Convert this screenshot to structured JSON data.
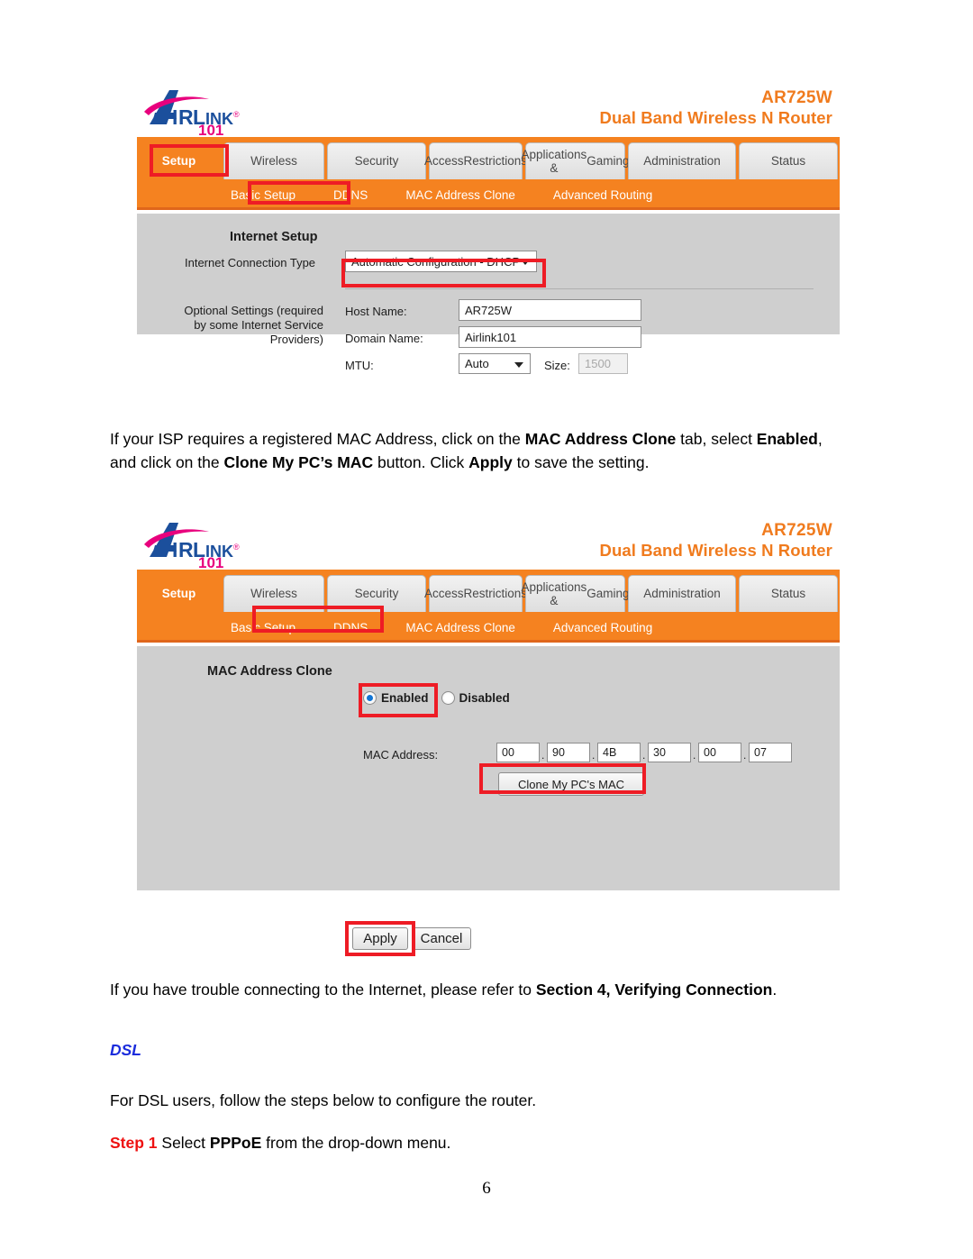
{
  "document": {
    "page_number": "6"
  },
  "router_ui": {
    "brand": {
      "logo_main": "IRLINK",
      "logo_letter": "A",
      "logo_sub": "101",
      "logo_reg": "®",
      "model": "AR725W",
      "description": "Dual Band Wireless N Router"
    },
    "tabs": [
      {
        "label": "Setup",
        "active": true
      },
      {
        "label": "Wireless",
        "active": false
      },
      {
        "label": "Security",
        "active": false
      },
      {
        "label": "Access\nRestrictions",
        "line1": "Access",
        "line2": "Restrictions",
        "active": false
      },
      {
        "label": "Applications &\nGaming",
        "line1": "Applications &",
        "line2": "Gaming",
        "active": false
      },
      {
        "label": "Administration",
        "active": false
      },
      {
        "label": "Status",
        "active": false
      }
    ],
    "subtabs": [
      {
        "label": "Basic Setup"
      },
      {
        "label": "DDNS"
      },
      {
        "label": "MAC Address Clone"
      },
      {
        "label": "Advanced Routing"
      }
    ]
  },
  "screenshot_1": {
    "active_subtab": "Basic Setup",
    "section_title": "Internet Setup",
    "connection_type_label": "Internet Connection Type",
    "connection_type_value": "Automatic Configuration - DHCP",
    "optional_settings_label_line1": "Optional Settings (required",
    "optional_settings_label_line2": "by some Internet Service",
    "optional_settings_label_line3": "Providers)",
    "host_name_label": "Host Name:",
    "host_name_value": "AR725W",
    "domain_name_label": "Domain Name:",
    "domain_name_value": "Airlink101",
    "mtu_label": "MTU:",
    "mtu_value": "Auto",
    "size_label": "Size:",
    "size_value": "1500"
  },
  "screenshot_2": {
    "active_subtab": "MAC Address Clone",
    "section_title": "MAC Address Clone",
    "enabled_label": "Enabled",
    "disabled_label": "Disabled",
    "enabled_selected": true,
    "mac_address_label": "MAC Address:",
    "mac_octets": [
      "00",
      "90",
      "4B",
      "30",
      "00",
      "07"
    ],
    "clone_button_label": "Clone My PC's MAC",
    "apply_button_label": "Apply",
    "cancel_button_label": "Cancel"
  },
  "body_text": {
    "paragraph_1": {
      "seg_1": "If your ISP requires a registered MAC Address, click on the ",
      "seg_2_bold": "MAC Address Clone",
      "seg_3": " tab, select ",
      "seg_4_bold": "Enabled",
      "seg_5": ", and click on the ",
      "seg_6_bold": "Clone My PC’s MAC",
      "seg_7": " button. Click ",
      "seg_8_bold": "Apply",
      "seg_9": " to save the setting."
    },
    "paragraph_2": {
      "seg_1": "If you have trouble connecting to the Internet, please refer to ",
      "seg_2_bold": "Section 4, Verifying Connection",
      "seg_3": "."
    },
    "dsl_heading": "DSL",
    "paragraph_3": "For DSL users, follow the steps below to configure the router.",
    "step_1": {
      "label": "Step 1",
      "seg_1": " Select ",
      "seg_2_bold": "PPPoE",
      "seg_3": " from the drop-down menu."
    }
  },
  "colors": {
    "orange": "#F58220",
    "orange_dark": "#E0661B",
    "logo_blue": "#1B4F9C",
    "logo_magenta": "#E8007D",
    "panel_gray": "#cfcfcf",
    "annotation_red": "#ee1c25",
    "dsl_blue": "#1b2cdc",
    "step_red": "#ee1111"
  }
}
